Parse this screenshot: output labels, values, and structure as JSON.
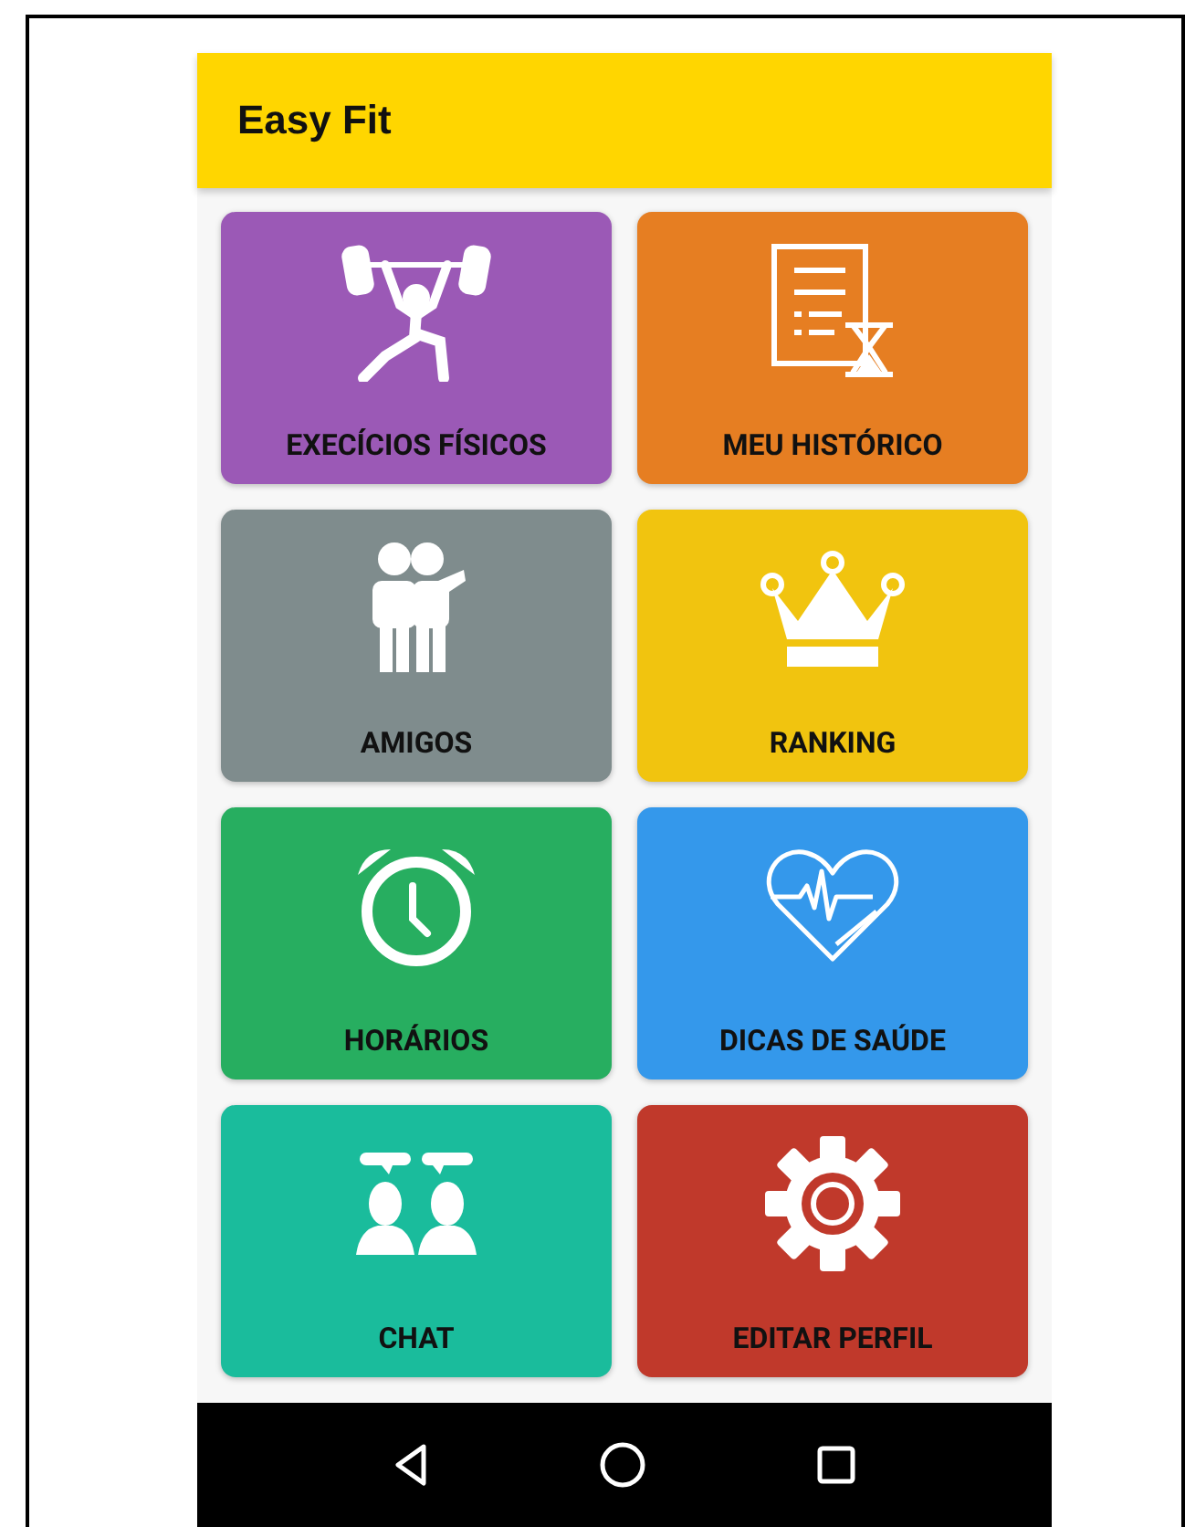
{
  "app_bar": {
    "title": "Easy Fit"
  },
  "tiles": [
    {
      "label": "EXECÍCIOS FÍSICOS",
      "color": "#9b59b6"
    },
    {
      "label": "MEU HISTÓRICO",
      "color": "#e67e22"
    },
    {
      "label": "AMIGOS",
      "color": "#7f8c8d"
    },
    {
      "label": "RANKING",
      "color": "#f1c40f"
    },
    {
      "label": "HORÁRIOS",
      "color": "#27ae60"
    },
    {
      "label": "DICAS DE SAÚDE",
      "color": "#3498eb"
    },
    {
      "label": "CHAT",
      "color": "#1abc9c"
    },
    {
      "label": "EDITAR PERFIL",
      "color": "#c0392b"
    }
  ]
}
